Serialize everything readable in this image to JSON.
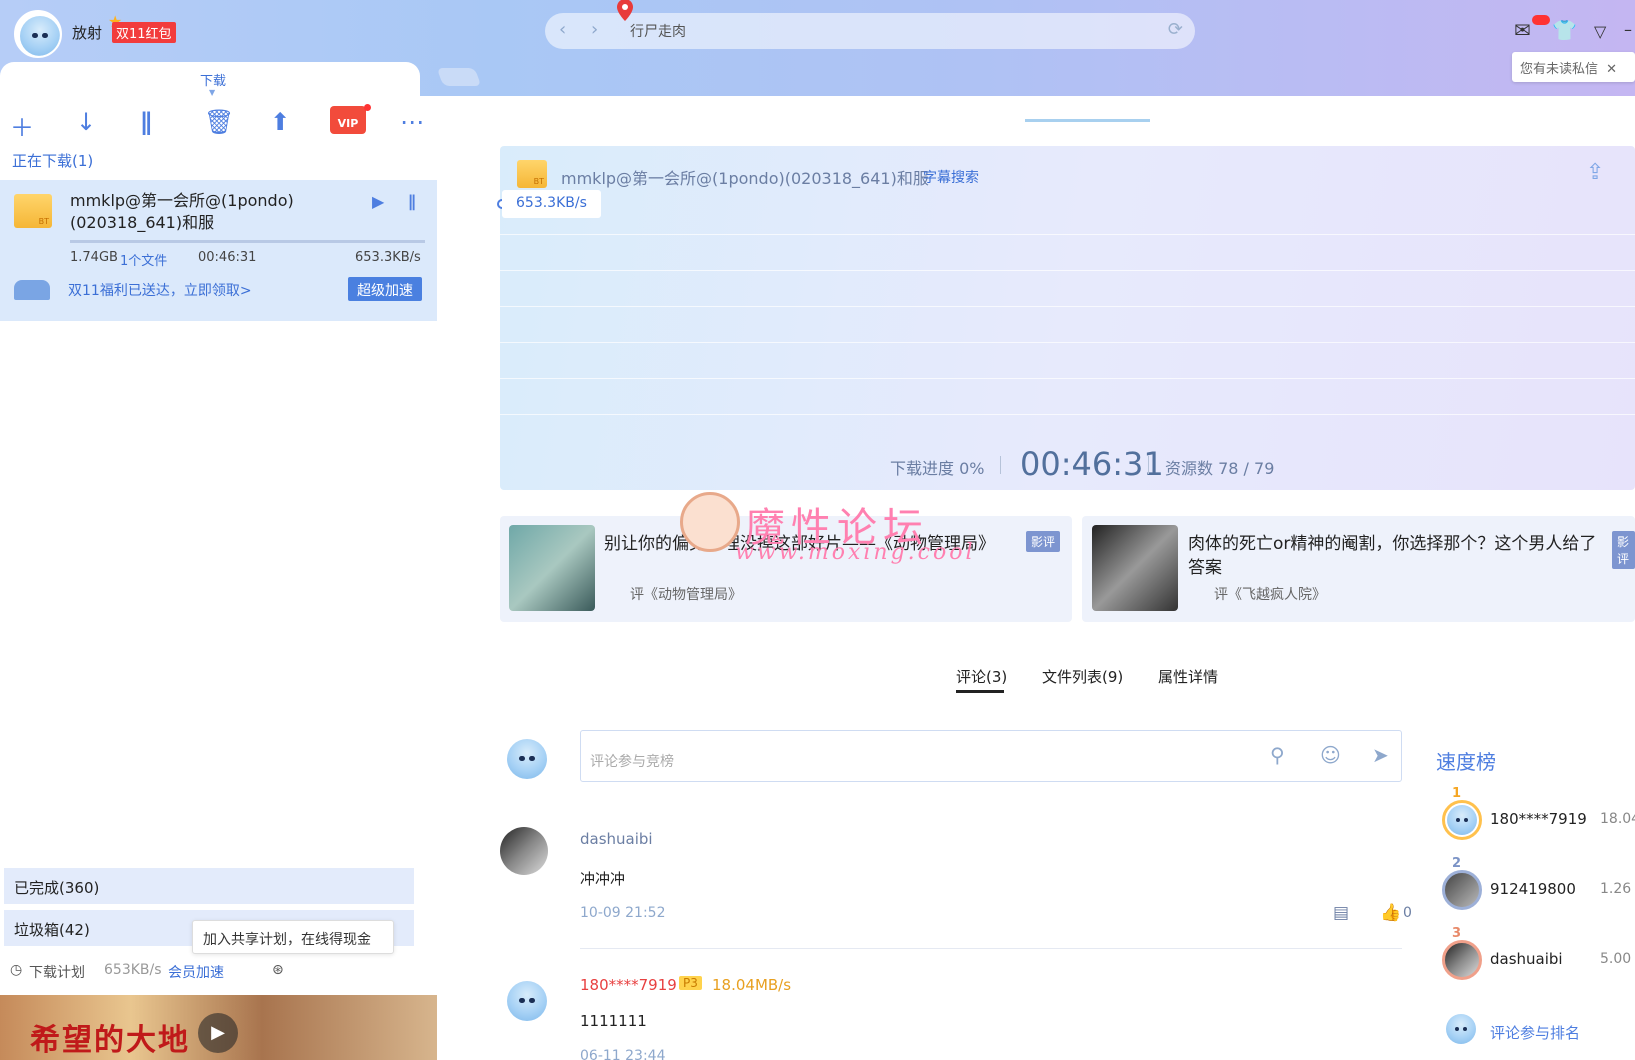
{
  "header": {
    "username": "放射",
    "red_packet": "双11红包",
    "search_text": "行尸走肉",
    "unread_tip": "您有未读私信"
  },
  "left": {
    "tab_label": "下载",
    "toolbar": [
      "add-icon",
      "download-icon",
      "pause-icon",
      "delete-icon",
      "upload-icon",
      "vip-icon",
      "more-icon"
    ],
    "vip_label": "VIP",
    "downloading_label": "正在下载(1)",
    "item": {
      "name": "mmklp@第一会所@(1pondo)(020318_641)和服",
      "size": "1.74GB",
      "files": "1个文件",
      "time": "00:46:31",
      "speed": "653.3KB/s",
      "promo": "双11福利已送达，立即领取>",
      "boost_button": "超级加速"
    },
    "completed": "已完成(360)",
    "trash": "垃圾箱(42)",
    "share_tip": "加入共享计划，在线得现金",
    "plan": "下载计划",
    "bottom_speed": "653KB/s",
    "member_boost": "会员加速",
    "banner_title": "希望的大地"
  },
  "main": {
    "task_title": "mmklp@第一会所@(1pondo)(020318_641)和服",
    "subtitle_search": "字幕搜索",
    "speed": "653.3KB/s",
    "progress_label": "下载进度 0%",
    "time_left": "00:46:31",
    "resources": "资源数 78 / 79",
    "reviews": [
      {
        "title": "别让你的偏见，埋没掉这部好片——《动物管理局》",
        "sub": "评《动物管理局》",
        "tag": "影评"
      },
      {
        "title": "肉体的死亡or精神的阉割，你选择那个？这个男人给了答案",
        "sub": "评《飞越疯人院》",
        "tag": "影评"
      }
    ],
    "watermark": {
      "title": "魔性论坛",
      "url": "www.moxing.cool"
    },
    "tabs": [
      "评论(3)",
      "文件列表(9)",
      "属性详情"
    ],
    "comment_placeholder": "评论参与竞榜",
    "comments": [
      {
        "user": "dashuaibi",
        "text": "冲冲冲",
        "time": "10-09 21:52",
        "likes": "0"
      },
      {
        "user": "180****7919",
        "badge": "P3",
        "speed": "18.04MB/s",
        "text": "1111111",
        "time": "06-11 23:44"
      }
    ]
  },
  "ranking": {
    "title": "速度榜",
    "items": [
      {
        "rank": "1",
        "name": "180****7919",
        "value": "18.04"
      },
      {
        "rank": "2",
        "name": "912419800",
        "value": "1.26"
      },
      {
        "rank": "3",
        "name": "dashuaibi",
        "value": "5.00"
      }
    ],
    "join": "评论参与排名"
  }
}
